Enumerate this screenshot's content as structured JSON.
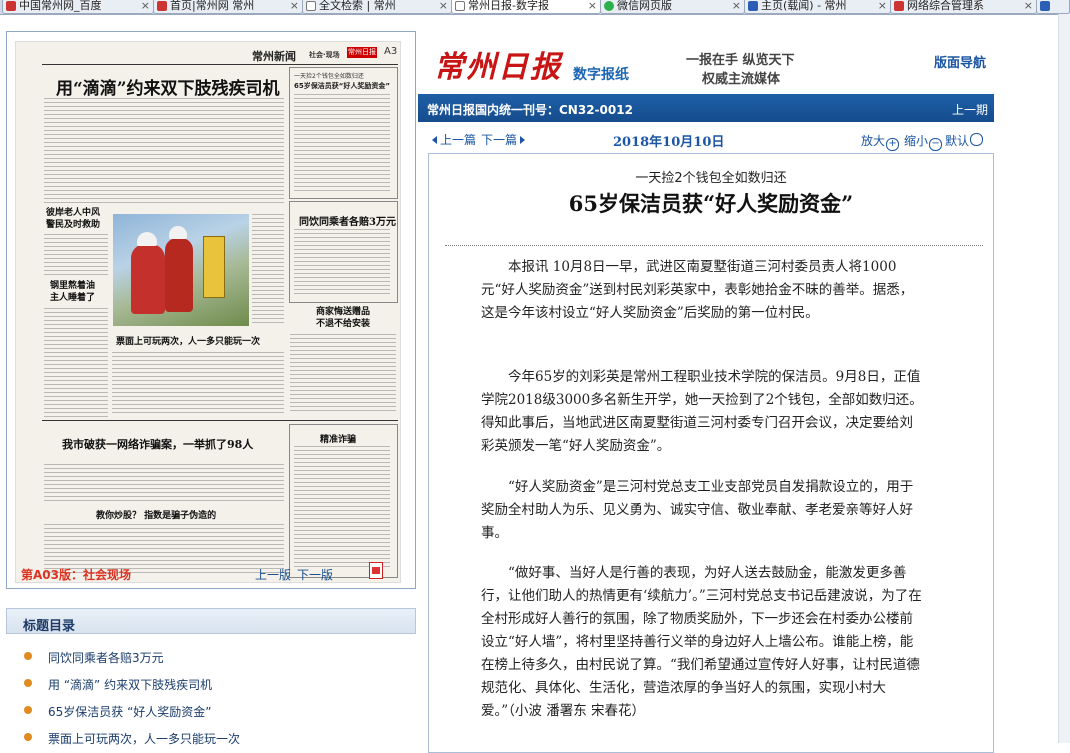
{
  "tabs": [
    {
      "label": "中国常州网_百度",
      "icon": "red"
    },
    {
      "label": "首页|常州网 常州",
      "icon": "red"
    },
    {
      "label": "全文检索 | 常州",
      "icon": "blank"
    },
    {
      "label": "常州日报-数字报",
      "icon": "blank",
      "active": true
    },
    {
      "label": "微信网页版",
      "icon": "wx"
    },
    {
      "label": "主页(载闻) - 常州",
      "icon": "blue"
    },
    {
      "label": "网络综合管理系",
      "icon": "red"
    },
    {
      "label": "",
      "icon": "blue"
    }
  ],
  "header": {
    "logo": "常州日报",
    "logo_sub": "数字报纸",
    "slogan_line1": "一报在手 纵览天下",
    "slogan_line2": "权威主流媒体",
    "nav_link": "版面导航",
    "cn_number": "常州日报国内统一刊号：CN32-0012",
    "prev_issue": "上一期"
  },
  "article_nav": {
    "prev": "上一篇",
    "next": "下一篇",
    "date": "2018年10月10日",
    "zoom_in": "放大",
    "zoom_out": "缩小",
    "default": "默认"
  },
  "article": {
    "pretitle": "一天捡2个钱包全如数归还",
    "title": "65岁保洁员获“好人奖励资金”",
    "paragraphs": [
      "本报讯 10月8日一早，武进区南夏墅街道三河村委员责人将1000元“好人奖励资金”送到村民刘彩英家中，表彰她拾金不昧的善举。据悉，这是今年该村设立“好人奖励资金”后奖励的第一位村民。",
      "今年65岁的刘彩英是常州工程职业技术学院的保洁员。9月8日，正值学院2018级3000多名新生开学，她一天捡到了2个钱包，全部如数归还。得知此事后，当地武进区南夏墅街道三河村委专门召开会议，决定要给刘彩英颁发一笔“好人奖励资金”。",
      "“好人奖励资金”是三河村党总支工业支部党员自发捐款设立的，用于奖励全村助人为乐、见义勇为、诚实守信、敬业奉献、孝老爱亲等好人好事。",
      "“做好事、当好人是行善的表现，为好人送去鼓励金，能激发更多善行，让他们助人的热情更有‘续航力’。”三河村党总支书记岳建波说，为了在全村形成好人善行的氛围，除了物质奖励外，下一步还会在村委办公楼前设立“好人墙”，将村里坚持善行义举的身边好人上墙公布。谁能上榜，能在榜上待多久，由村民说了算。“我们希望通过宣传好人好事，让村民道德规范化、具体化、生活化，营造浓厚的争当好人的氛围，实现小村大爱。”（小波 潘署东 宋春花）"
    ]
  },
  "page_preview": {
    "masthead": "常州新闻",
    "section": "社会·现场",
    "masthead_logo": "常州日报",
    "page_no": "A3",
    "headline": "用“滴滴”约来双下肢残疾司机",
    "subhead1": "一天捡2个钱包全如数归还",
    "subhead1b": "65岁保洁员获“好人奖励资金”",
    "story2": "同饮同乘者各赔3万元",
    "story3": "商家悔送赠品\n不退不给安装",
    "story4": "票面上可玩两次，人一多只能玩一次",
    "story5": "我市破获一网络诈骗案，一举抓了98人",
    "story6": "精准诈骗",
    "story7": "教你炒股？ 指数是骗子伪造的",
    "side1": "彼岸老人中风\n警民及时救助",
    "side2": "钢里熬着油\n主人睡着了"
  },
  "page_footer": {
    "label": "第A03版：社会现场",
    "prev": "上一版",
    "next": "下一版"
  },
  "toc": {
    "title": "标题目录",
    "items": [
      "同饮同乘者各赔3万元",
      "用 “滴滴” 约来双下肢残疾司机",
      "65岁保洁员获 “好人奖励资金”",
      "票面上可玩两次，人一多只能玩一次"
    ]
  },
  "colors": {
    "accent": "#c81414",
    "brand_blue": "#1b55a3",
    "bar_blue": "#1f5fa6"
  }
}
